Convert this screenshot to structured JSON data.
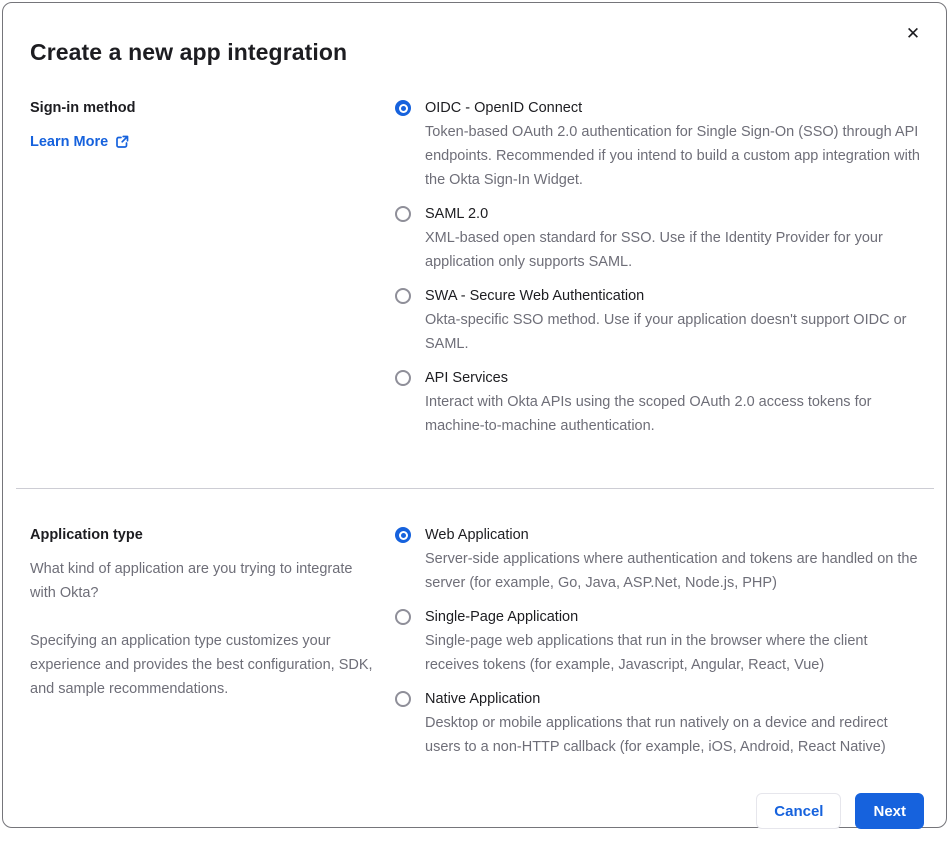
{
  "dialog": {
    "title": "Create a new app integration",
    "close_icon": "✕"
  },
  "signin_section": {
    "label": "Sign-in method",
    "learn_more_label": "Learn More",
    "options": [
      {
        "label": "OIDC - OpenID Connect",
        "description": "Token-based OAuth 2.0 authentication for Single Sign-On (SSO) through API endpoints. Recommended if you intend to build a custom app integration with the Okta Sign-In Widget.",
        "selected": true
      },
      {
        "label": "SAML 2.0",
        "description": "XML-based open standard for SSO. Use if the Identity Provider for your application only supports SAML.",
        "selected": false
      },
      {
        "label": "SWA - Secure Web Authentication",
        "description": "Okta-specific SSO method. Use if your application doesn't support OIDC or SAML.",
        "selected": false
      },
      {
        "label": "API Services",
        "description": "Interact with Okta APIs using the scoped OAuth 2.0 access tokens for machine-to-machine authentication.",
        "selected": false
      }
    ]
  },
  "apptype_section": {
    "label": "Application type",
    "description_1": "What kind of application are you trying to integrate with Okta?",
    "description_2": "Specifying an application type customizes your experience and provides the best configuration, SDK, and sample recommendations.",
    "options": [
      {
        "label": "Web Application",
        "description": "Server-side applications where authentication and tokens are handled on the server (for example, Go, Java, ASP.Net, Node.js, PHP)",
        "selected": true
      },
      {
        "label": "Single-Page Application",
        "description": "Single-page web applications that run in the browser where the client receives tokens (for example, Javascript, Angular, React, Vue)",
        "selected": false
      },
      {
        "label": "Native Application",
        "description": "Desktop or mobile applications that run natively on a device and redirect users to a non-HTTP callback (for example, iOS, Android, React Native)",
        "selected": false
      }
    ]
  },
  "footer": {
    "cancel_label": "Cancel",
    "next_label": "Next"
  },
  "colors": {
    "accent": "#1662dd",
    "text_dark": "#1d1d21",
    "text_gray": "#6e6e78",
    "divider": "#cdcdd4"
  }
}
